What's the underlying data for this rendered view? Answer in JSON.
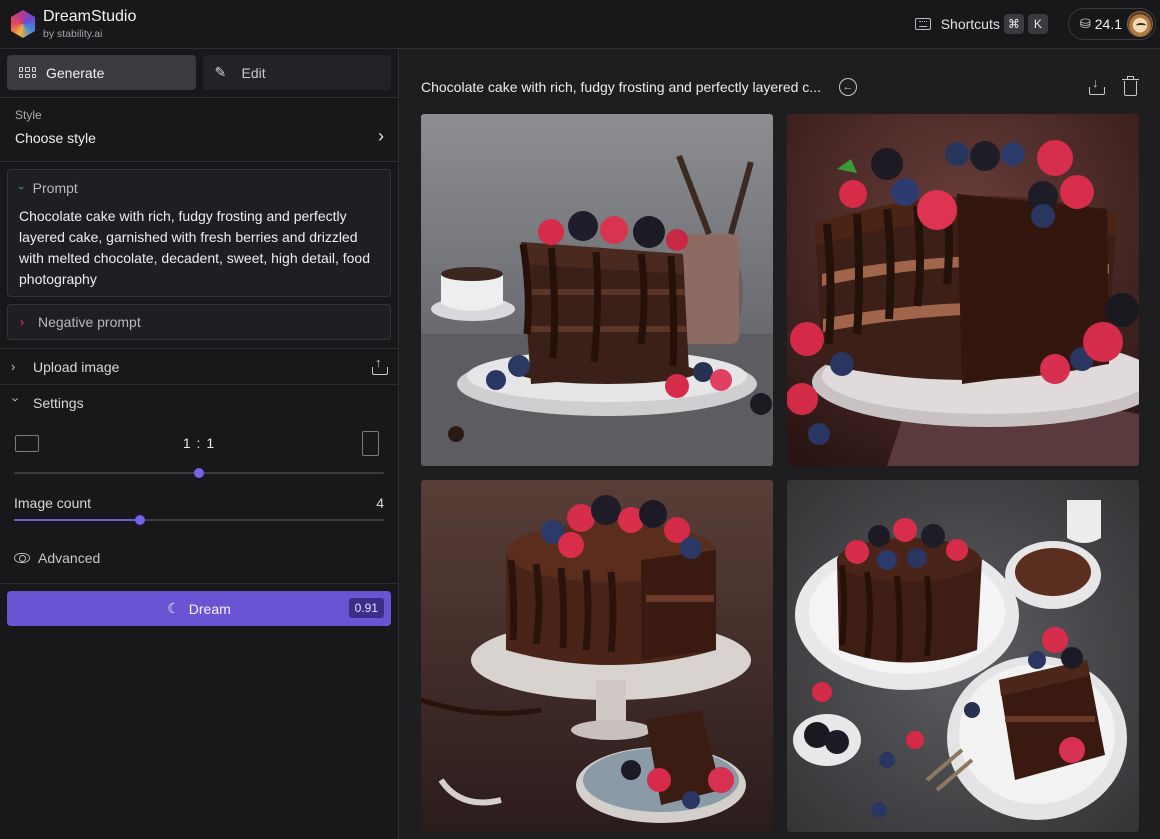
{
  "app": {
    "name": "DreamStudio",
    "byline": "by stability.ai"
  },
  "header": {
    "shortcuts_label": "Shortcuts",
    "shortcut_keys": [
      "⌘",
      "K"
    ],
    "credits": "24.1"
  },
  "sidebar": {
    "tabs": [
      {
        "label": "Generate",
        "active": true
      },
      {
        "label": "Edit",
        "active": false
      }
    ],
    "style": {
      "label": "Style",
      "value": "Choose style"
    },
    "prompt": {
      "label": "Prompt",
      "text": "Chocolate cake with rich, fudgy frosting and perfectly layered cake, garnished with fresh berries and drizzled with melted chocolate, decadent, sweet, high detail, food photography"
    },
    "negative_prompt": {
      "label": "Negative prompt"
    },
    "upload_image": {
      "label": "Upload image"
    },
    "settings": {
      "label": "Settings",
      "aspect_ratio": "1 : 1",
      "aspect_ratio_position": 0.5,
      "image_count_label": "Image count",
      "image_count": "4",
      "image_count_position": 0.34,
      "advanced_label": "Advanced"
    },
    "dream_button": {
      "label": "Dream",
      "cost": "0.91"
    }
  },
  "main": {
    "title": "Chocolate cake with rich, fudgy frosting and perfectly layered c...",
    "images": [
      {
        "icon": "chocolate-cake-slice-image"
      },
      {
        "icon": "chocolate-layer-cake-image"
      },
      {
        "icon": "chocolate-cake-stand-image"
      },
      {
        "icon": "chocolate-cake-plates-image"
      }
    ]
  },
  "colors": {
    "accent": "#6a54d3",
    "slider": "#7464e6",
    "background": "#1b1b1e",
    "prompt_chevron": "#41b883",
    "negative_chevron": "#e5484d"
  }
}
